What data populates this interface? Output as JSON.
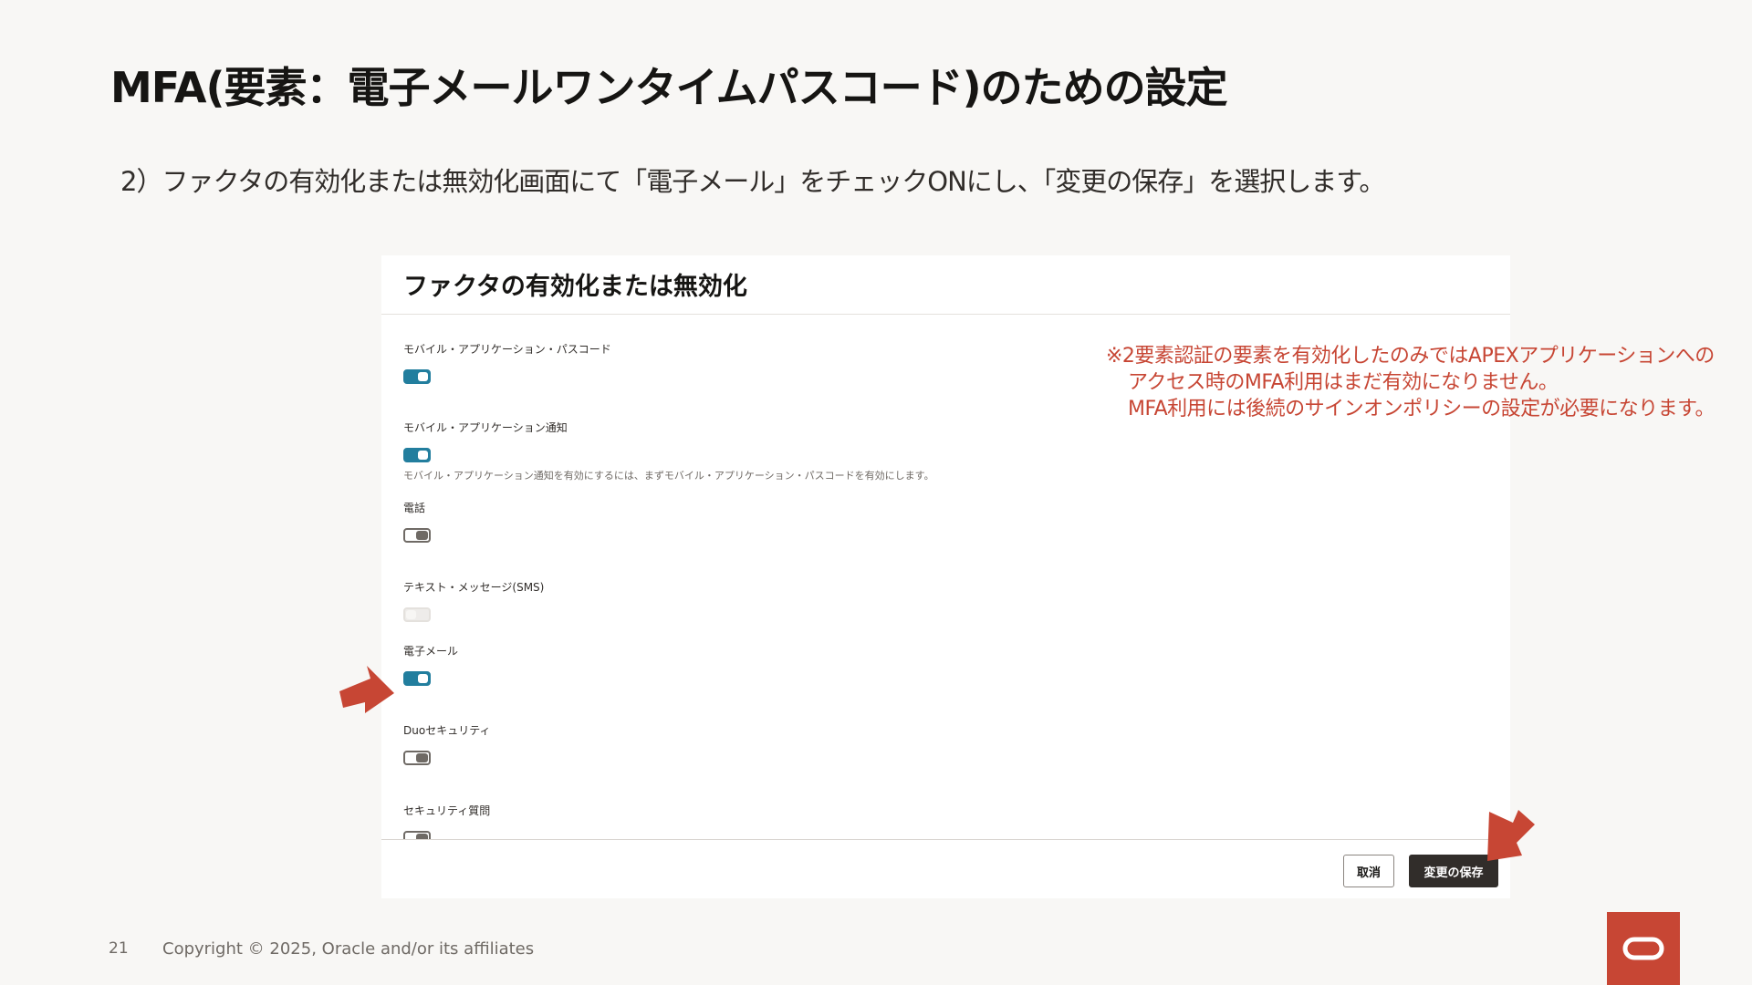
{
  "slide": {
    "title": "MFA(要素：電子メールワンタイムパスコード)のための設定",
    "instruction": "2）ファクタの有効化または無効化画面にて「電子メール」をチェックONにし、「変更の保存」を選択します。"
  },
  "panel": {
    "title": "ファクタの有効化または無効化",
    "factors": [
      {
        "label": "モバイル・アプリケーション・パスコード",
        "state": "on",
        "help": ""
      },
      {
        "label": "モバイル・アプリケーション通知",
        "state": "on",
        "help": "モバイル・アプリケーション通知を有効にするには、まずモバイル・アプリケーション・パスコードを有効にします。"
      },
      {
        "label": "電話",
        "state": "off",
        "help": ""
      },
      {
        "label": "テキスト・メッセージ(SMS)",
        "state": "disabled",
        "help": ""
      },
      {
        "label": "電子メール",
        "state": "on",
        "help": ""
      },
      {
        "label": "Duoセキュリティ",
        "state": "off",
        "help": ""
      },
      {
        "label": "セキュリティ質問",
        "state": "off",
        "help": ""
      }
    ],
    "buttons": {
      "cancel": "取消",
      "save": "変更の保存"
    }
  },
  "note": {
    "line1": "※2要素認証の要素を有効化したのみではAPEXアプリケーションへの",
    "line2": "アクセス時のMFA利用はまだ有効になりません。",
    "line3": "MFA利用には後続のサインオンポリシーの設定が必要になります。"
  },
  "footer": {
    "page_number": "21",
    "copyright": "Copyright © 2025, Oracle and/or its affiliates"
  },
  "colors": {
    "accent": "#c74634",
    "toggle_on": "#227e9e",
    "save_button": "#312d2a"
  },
  "icons": {
    "arrow": "red-pointer-arrow-icon",
    "logo": "oracle-logo-icon"
  }
}
